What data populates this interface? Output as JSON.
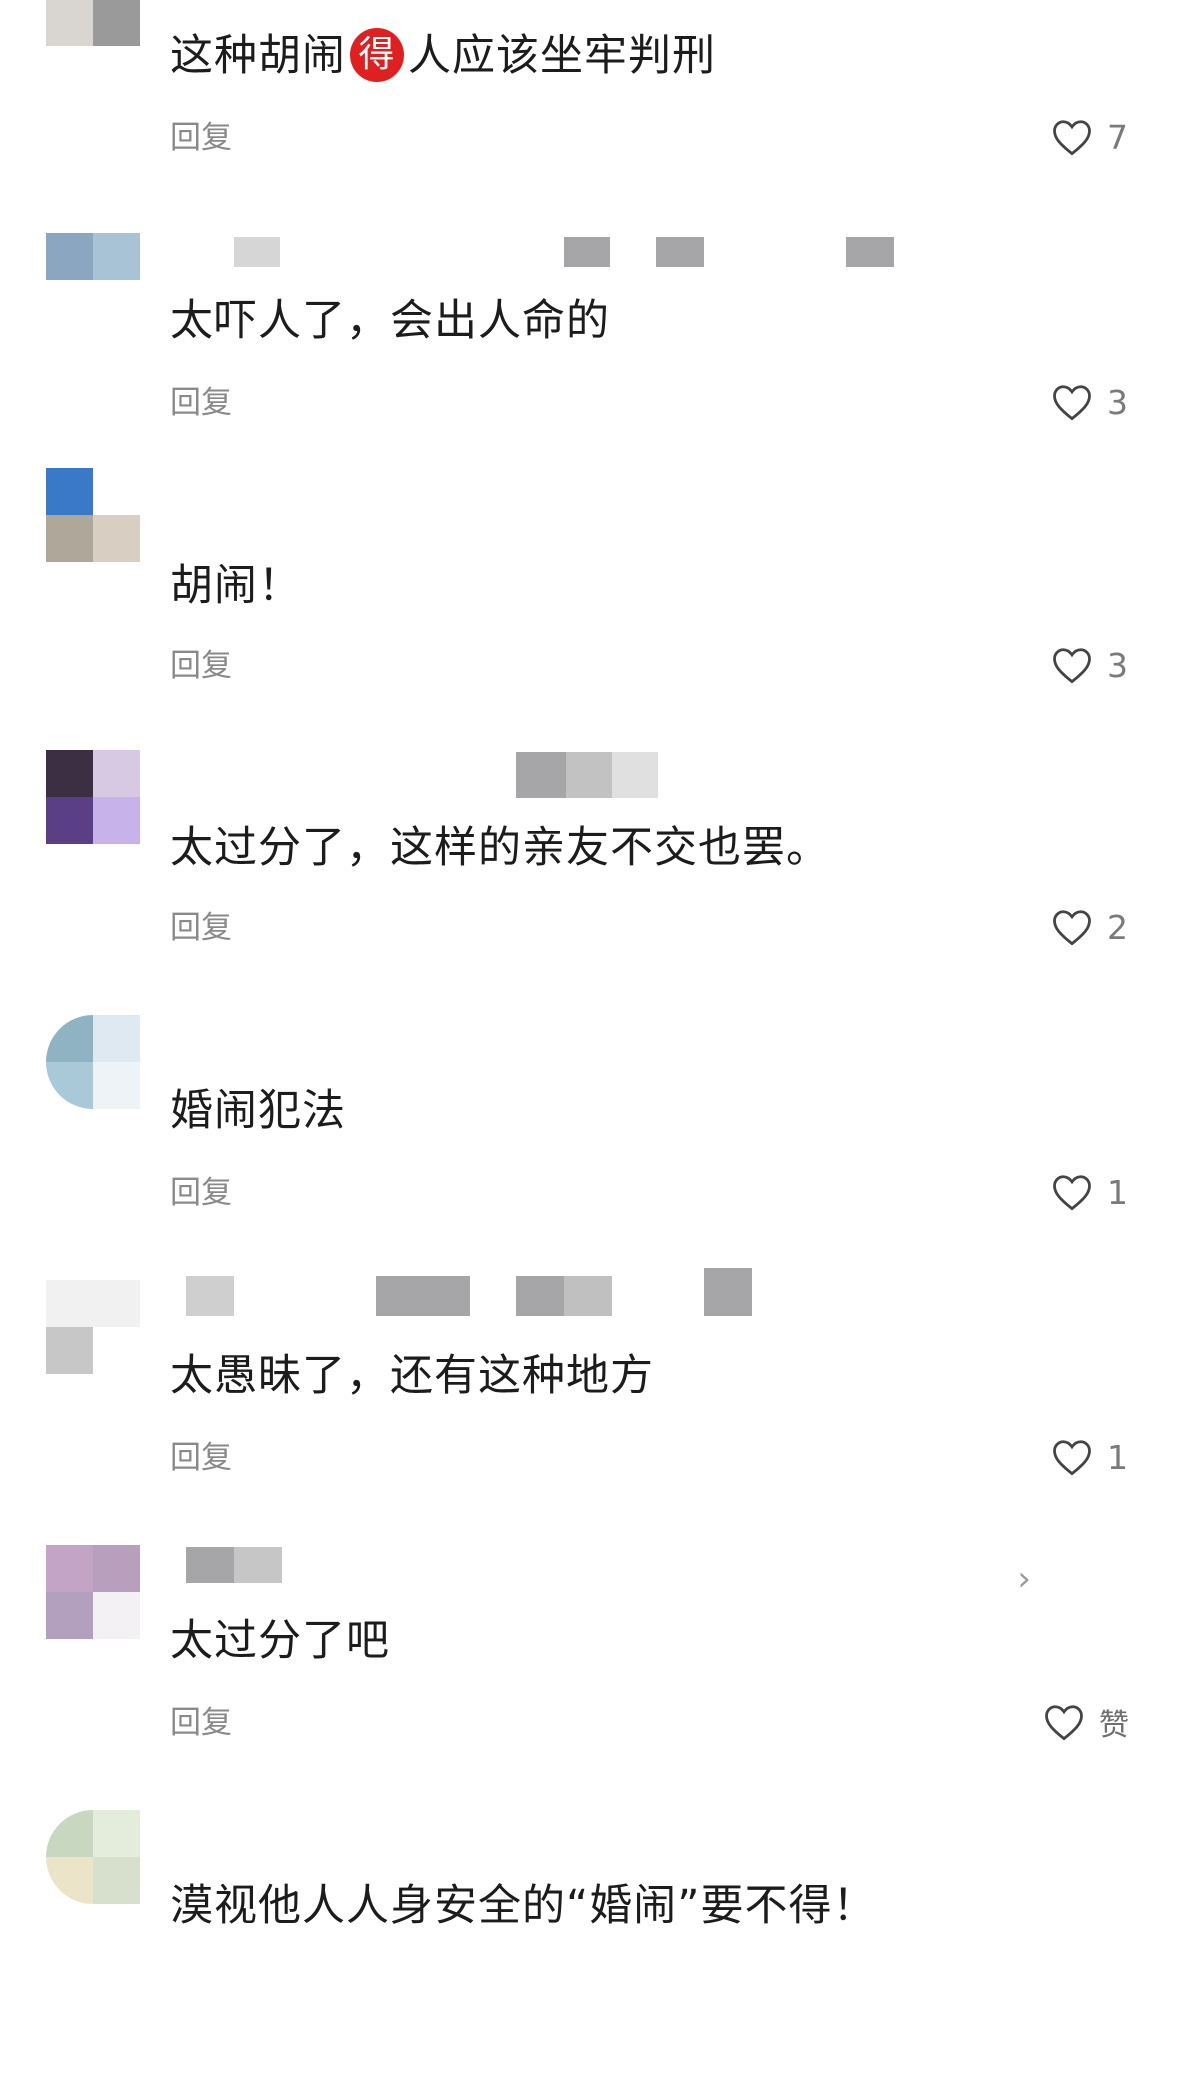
{
  "comments": [
    {
      "text_before": "这种胡闹",
      "badge": "得",
      "text_after": "人应该坐牢判刑",
      "reply": "回复",
      "likes": "7"
    },
    {
      "text": "太吓人了，会出人命的",
      "reply": "回复",
      "likes": "3"
    },
    {
      "text": "胡闹！",
      "reply": "回复",
      "likes": "3"
    },
    {
      "text": "太过分了，这样的亲友不交也罢。",
      "reply": "回复",
      "likes": "2"
    },
    {
      "text": "婚闹犯法",
      "reply": "回复",
      "likes": "1"
    },
    {
      "text": "太愚昧了，还有这种地方",
      "reply": "回复",
      "likes": "1"
    },
    {
      "text": "太过分了吧",
      "reply": "回复",
      "likes": "赞",
      "chevron": "›"
    },
    {
      "text": "漠视他人人身安全的“婚闹”要不得！"
    }
  ],
  "icons": {
    "like": "heart-outline-icon",
    "chevron": "chevron-right-icon"
  },
  "colors": {
    "text": "#1c1c1c",
    "meta": "#8a8a8a",
    "badge": "#e02020"
  }
}
